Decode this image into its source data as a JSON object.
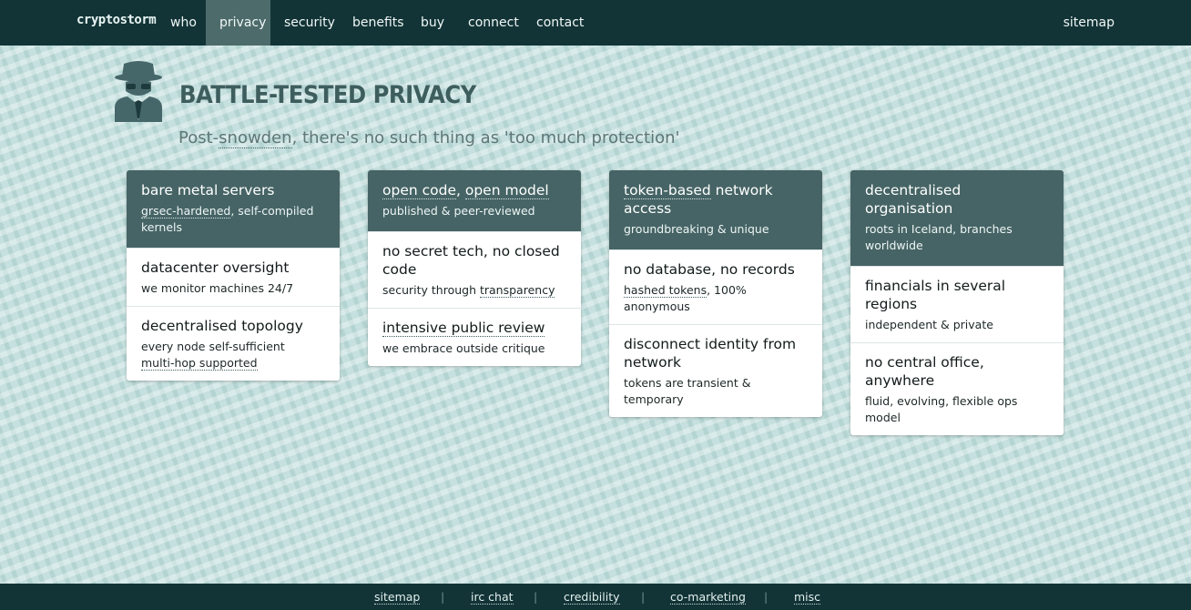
{
  "nav": {
    "logo": "cryptostorm",
    "items": [
      {
        "label": "who",
        "active": false
      },
      {
        "label": "privacy",
        "active": true
      },
      {
        "label": "security",
        "active": false
      },
      {
        "label": "benefits",
        "active": false
      },
      {
        "label": "buy",
        "active": false
      },
      {
        "label": "connect",
        "active": false
      },
      {
        "label": "contact",
        "active": false
      }
    ],
    "sitemap": "sitemap"
  },
  "hero": {
    "title": "Battle-Tested Privacy",
    "subtitle_pre": "Post-",
    "subtitle_link": "snowden",
    "subtitle_post": ", there's no such thing as 'too much protection'"
  },
  "cards": [
    {
      "header": {
        "title": "bare metal servers",
        "sub_link": "grsec-hardened",
        "sub_rest": ", self-compiled kernels"
      },
      "rows": [
        {
          "title": "datacenter oversight",
          "sub": "we monitor machines 24/7"
        },
        {
          "title": "decentralised topology",
          "sub": "every node self-sufficient",
          "sub2_link": "multi-hop supported"
        }
      ]
    },
    {
      "header": {
        "title_link1": "open code",
        "title_mid": ", ",
        "title_link2": "open model",
        "sub": "published & peer-reviewed"
      },
      "rows": [
        {
          "title": "no secret tech, no closed code",
          "sub_pre": "security through ",
          "sub_link": "transparency"
        },
        {
          "title_link": "intensive public review",
          "sub": "we embrace outside critique"
        }
      ]
    },
    {
      "header": {
        "title_link": "token-based",
        "title_rest": " network access",
        "sub": "groundbreaking & unique"
      },
      "rows": [
        {
          "title": "no database, no records",
          "sub_link": "hashed tokens",
          "sub_rest": ", 100% anonymous"
        },
        {
          "title": "disconnect identity from network",
          "sub": "tokens are transient & temporary"
        }
      ]
    },
    {
      "header": {
        "title": "decentralised organisation",
        "sub": "roots in Iceland, branches worldwide"
      },
      "rows": [
        {
          "title": "financials in several regions",
          "sub": "independent & private"
        },
        {
          "title": "no central office, anywhere",
          "sub": "fluid, evolving, flexible ops model"
        }
      ]
    }
  ],
  "footer": {
    "links": [
      "sitemap",
      "irc chat",
      "credibility",
      "co-marketing",
      "misc"
    ],
    "separator": "|"
  },
  "colors": {
    "nav_bg": "#123436",
    "nav_active": "#4d6b6b",
    "card_header": "#466465",
    "title": "#3e5e5e",
    "background": "#c5e0de"
  },
  "icons": {
    "hero": "spy-icon"
  }
}
